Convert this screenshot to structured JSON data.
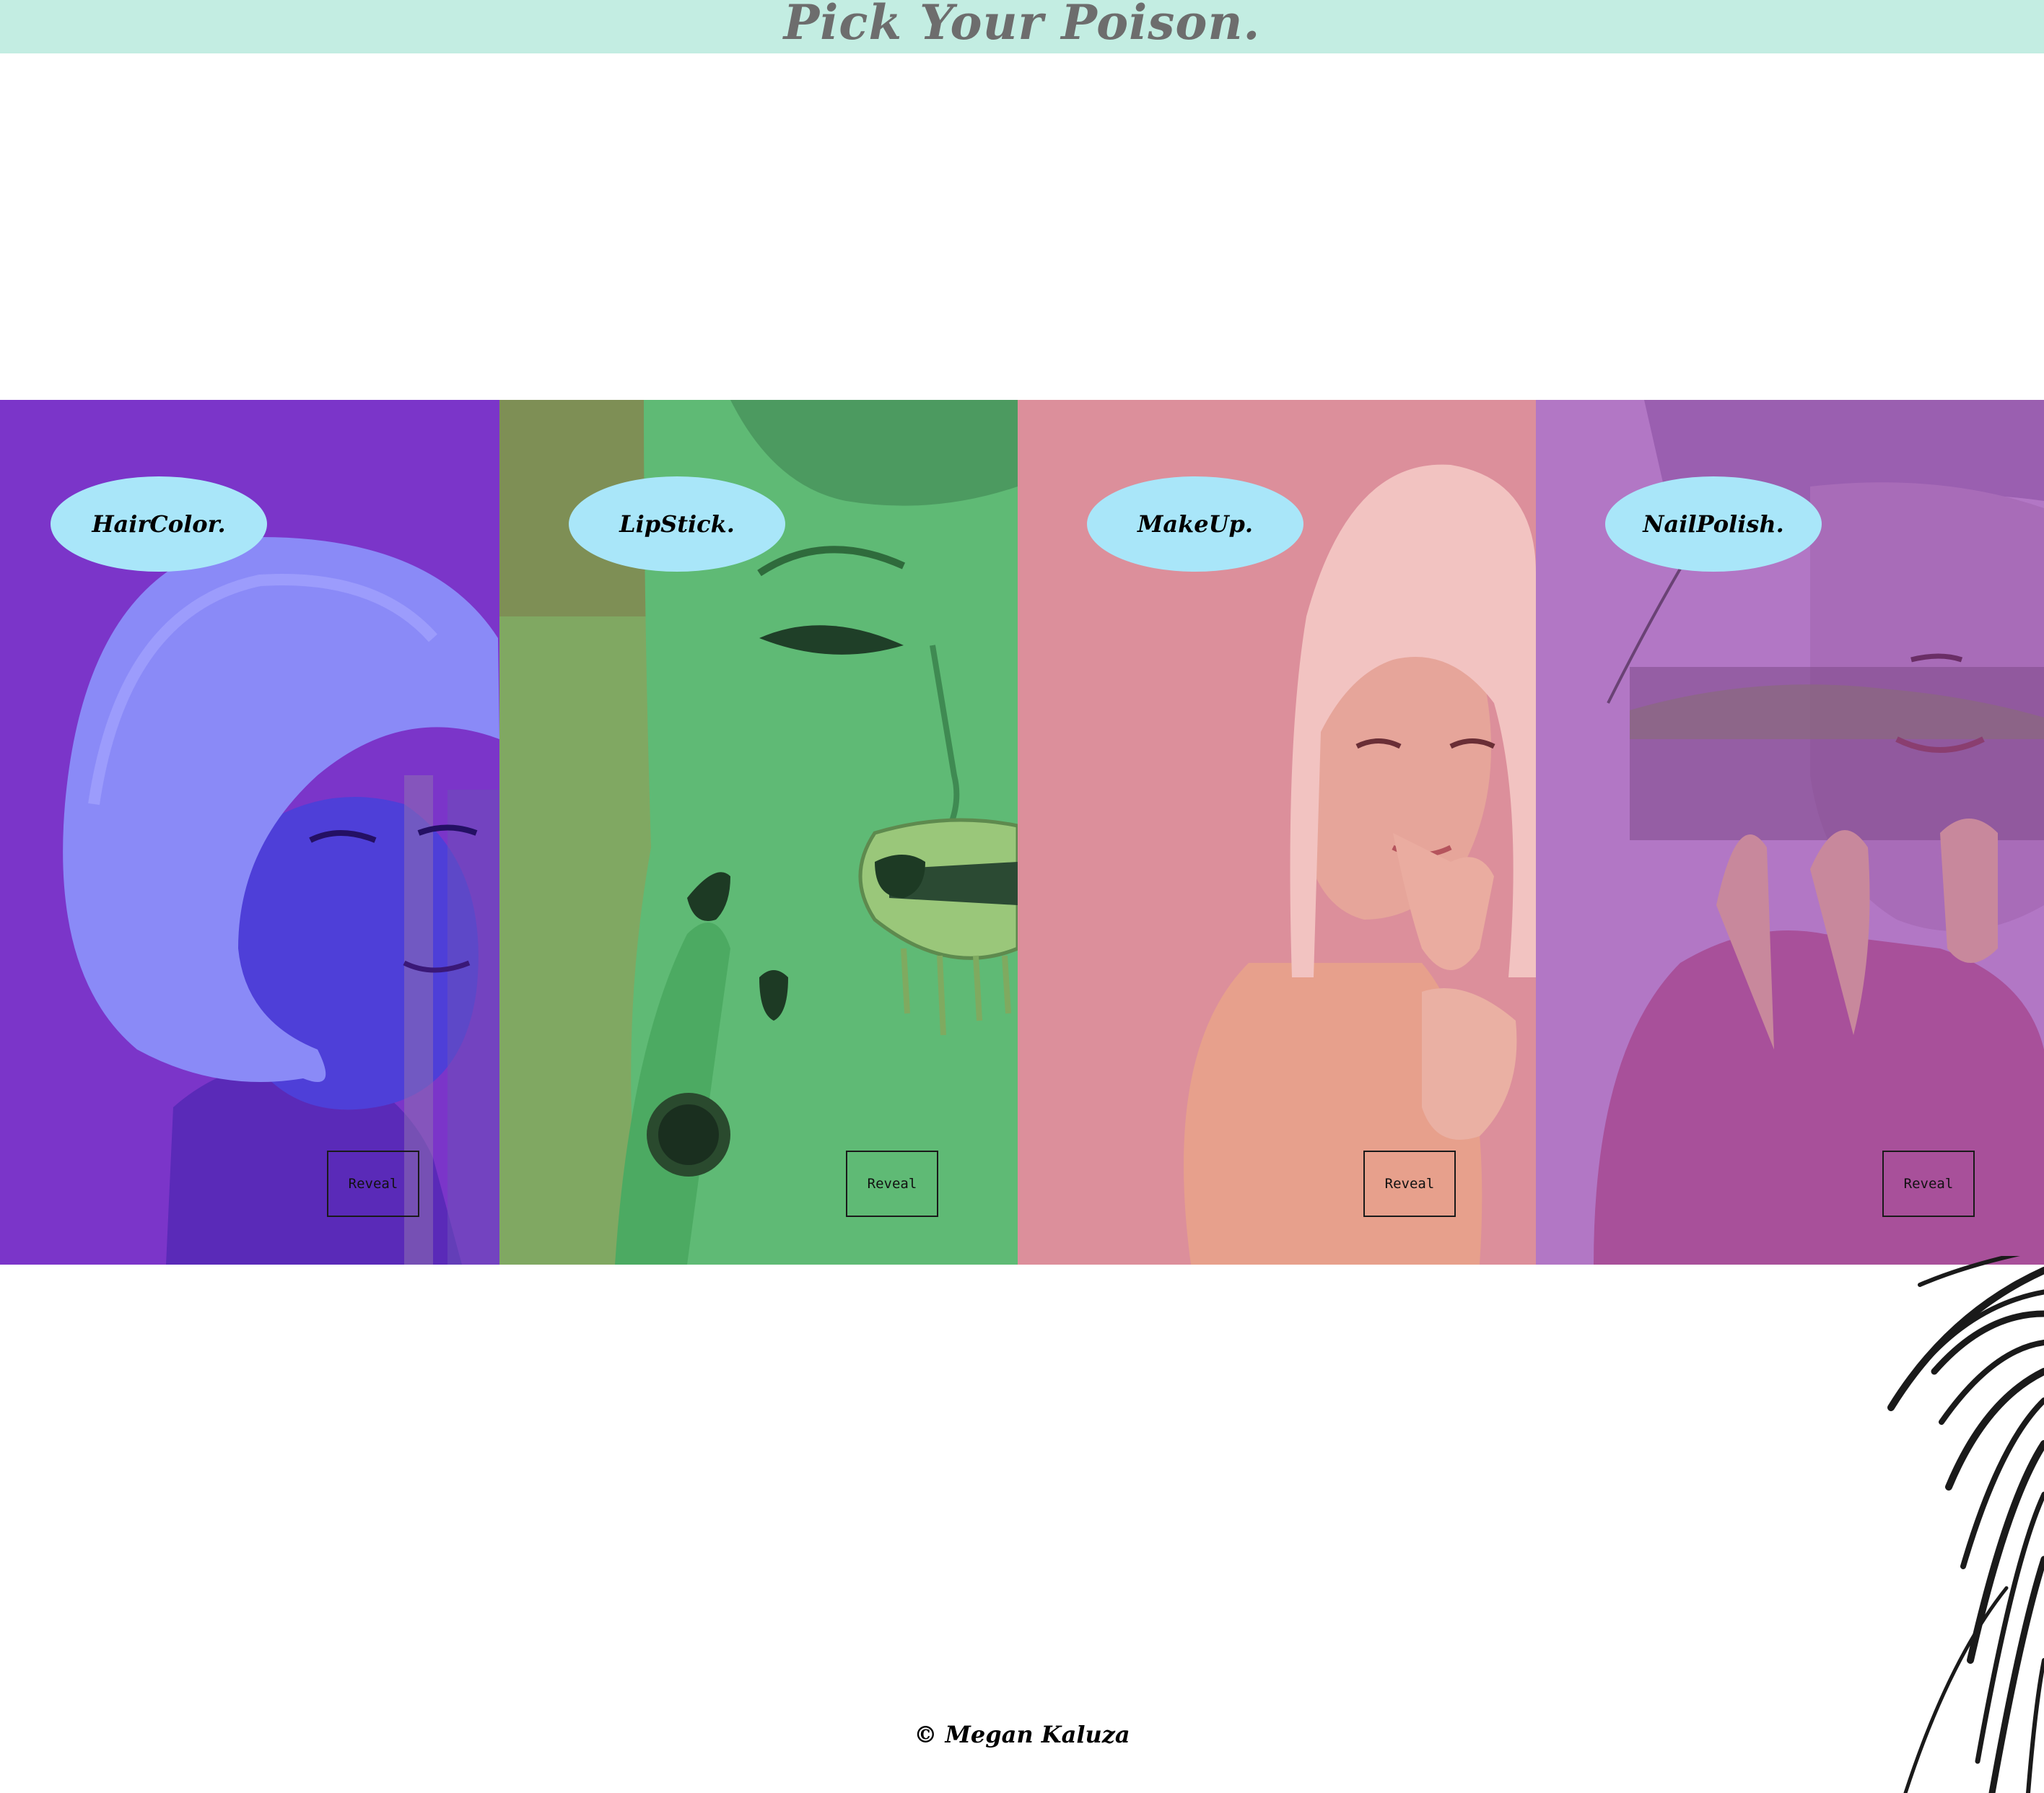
{
  "header": {
    "title": "Pick Your Poison.",
    "background": "#c3ede2",
    "title_color": "#6d6d6d"
  },
  "panels": [
    {
      "label": "HairColor.",
      "button": "Reveal",
      "tint": "#7b35c9"
    },
    {
      "label": "LipStick.",
      "button": "Reveal",
      "tint": "#5faa63"
    },
    {
      "label": "MakeUp.",
      "button": "Reveal",
      "tint": "#dc8f9b"
    },
    {
      "label": "NailPolish.",
      "button": "Reveal",
      "tint": "#b277c5"
    }
  ],
  "oval_color": "#a9e6f9",
  "footer": {
    "credit": "© Megan Kaluza"
  }
}
